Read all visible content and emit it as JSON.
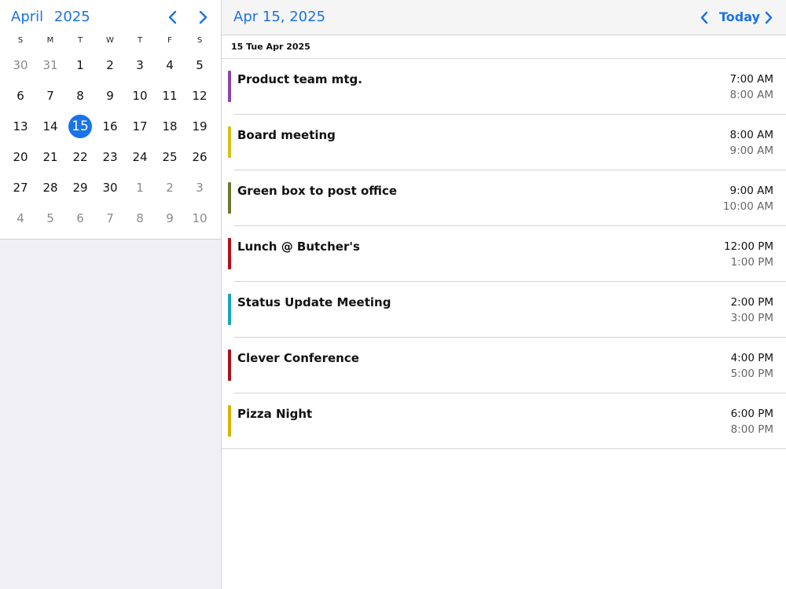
{
  "calendar": {
    "month": "April",
    "year": "2025",
    "weekdays": [
      "S",
      "M",
      "T",
      "W",
      "T",
      "F",
      "S"
    ],
    "weeks": [
      [
        {
          "d": "30",
          "m": true
        },
        {
          "d": "31",
          "m": true
        },
        {
          "d": "1"
        },
        {
          "d": "2"
        },
        {
          "d": "3"
        },
        {
          "d": "4"
        },
        {
          "d": "5"
        }
      ],
      [
        {
          "d": "6"
        },
        {
          "d": "7"
        },
        {
          "d": "8"
        },
        {
          "d": "9"
        },
        {
          "d": "10"
        },
        {
          "d": "11"
        },
        {
          "d": "12"
        }
      ],
      [
        {
          "d": "13"
        },
        {
          "d": "14"
        },
        {
          "d": "15",
          "sel": true
        },
        {
          "d": "16"
        },
        {
          "d": "17"
        },
        {
          "d": "18"
        },
        {
          "d": "19"
        }
      ],
      [
        {
          "d": "20"
        },
        {
          "d": "21"
        },
        {
          "d": "22"
        },
        {
          "d": "23"
        },
        {
          "d": "24"
        },
        {
          "d": "25"
        },
        {
          "d": "26"
        }
      ],
      [
        {
          "d": "27"
        },
        {
          "d": "28"
        },
        {
          "d": "29"
        },
        {
          "d": "30"
        },
        {
          "d": "1",
          "m": true
        },
        {
          "d": "2",
          "m": true
        },
        {
          "d": "3",
          "m": true
        }
      ],
      [
        {
          "d": "4",
          "m": true
        },
        {
          "d": "5",
          "m": true
        },
        {
          "d": "6",
          "m": true
        },
        {
          "d": "7",
          "m": true
        },
        {
          "d": "8",
          "m": true
        },
        {
          "d": "9",
          "m": true
        },
        {
          "d": "10",
          "m": true
        }
      ]
    ],
    "prev_icon": "chevron-left-icon",
    "next_icon": "chevron-right-icon"
  },
  "header": {
    "date": "Apr 15, 2025",
    "today_label": "Today",
    "day_label": "15 Tue Apr 2025"
  },
  "colors": {
    "accent": "#1a73e8"
  },
  "events": [
    {
      "title": "Product team mtg.",
      "start": "7:00 AM",
      "end": "8:00 AM",
      "color": "#8e44ad"
    },
    {
      "title": "Board meeting",
      "start": "8:00 AM",
      "end": "9:00 AM",
      "color": "#d4bf16"
    },
    {
      "title": "Green box to post office",
      "start": "9:00 AM",
      "end": "10:00 AM",
      "color": "#6b7a2c"
    },
    {
      "title": "Lunch @ Butcher's",
      "start": "12:00 PM",
      "end": "1:00 PM",
      "color": "#b3101a"
    },
    {
      "title": "Status Update Meeting",
      "start": "2:00 PM",
      "end": "3:00 PM",
      "color": "#1aa6b8"
    },
    {
      "title": "Clever Conference",
      "start": "4:00 PM",
      "end": "5:00 PM",
      "color": "#a8121a"
    },
    {
      "title": "Pizza Night",
      "start": "6:00 PM",
      "end": "8:00 PM",
      "color": "#d9b300"
    }
  ]
}
